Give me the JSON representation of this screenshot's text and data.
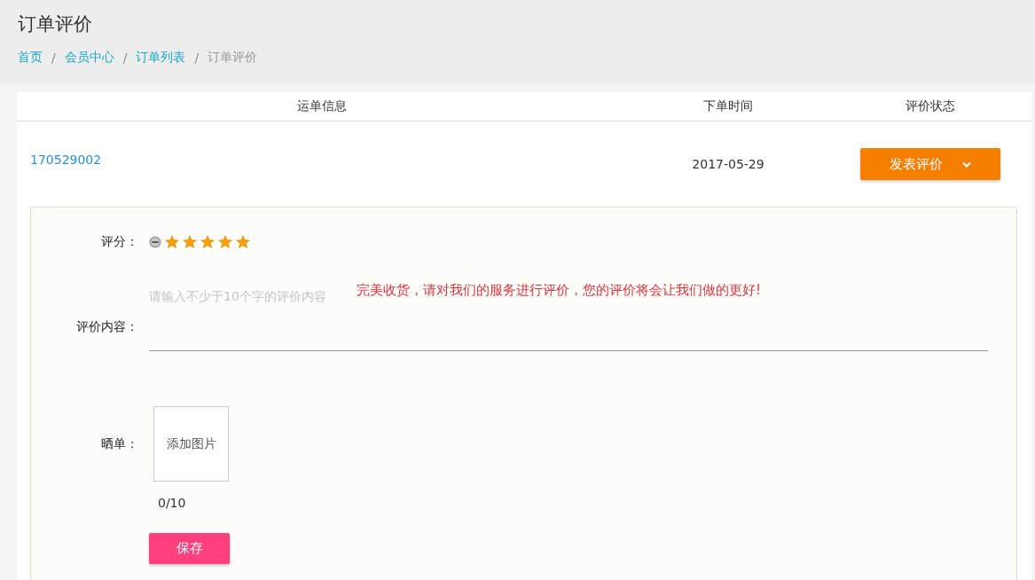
{
  "page": {
    "title": "订单评价"
  },
  "breadcrumb": [
    {
      "label": "首页",
      "link": true
    },
    {
      "label": "会员中心",
      "link": true
    },
    {
      "label": "订单列表",
      "link": true
    },
    {
      "label": "订单评价",
      "link": false
    }
  ],
  "breadcrumb_separator": "/",
  "table": {
    "columns": [
      "运单信息",
      "下单时间",
      "评价状态"
    ],
    "order": {
      "number": "170529002",
      "date": "2017-05-29",
      "action": "发表评价",
      "expanded": true
    }
  },
  "review": {
    "score_label": "评分：",
    "stars": 5,
    "content_label": "评价内容：",
    "placeholder": "请输入不少于10个字的评价内容",
    "hint": "完美收货，请对我们的服务进行评价，您的评价将会让我们做的更好!",
    "photo_label": "晒单：",
    "upload": "添加图片",
    "count": "0/10",
    "save": "保存"
  }
}
